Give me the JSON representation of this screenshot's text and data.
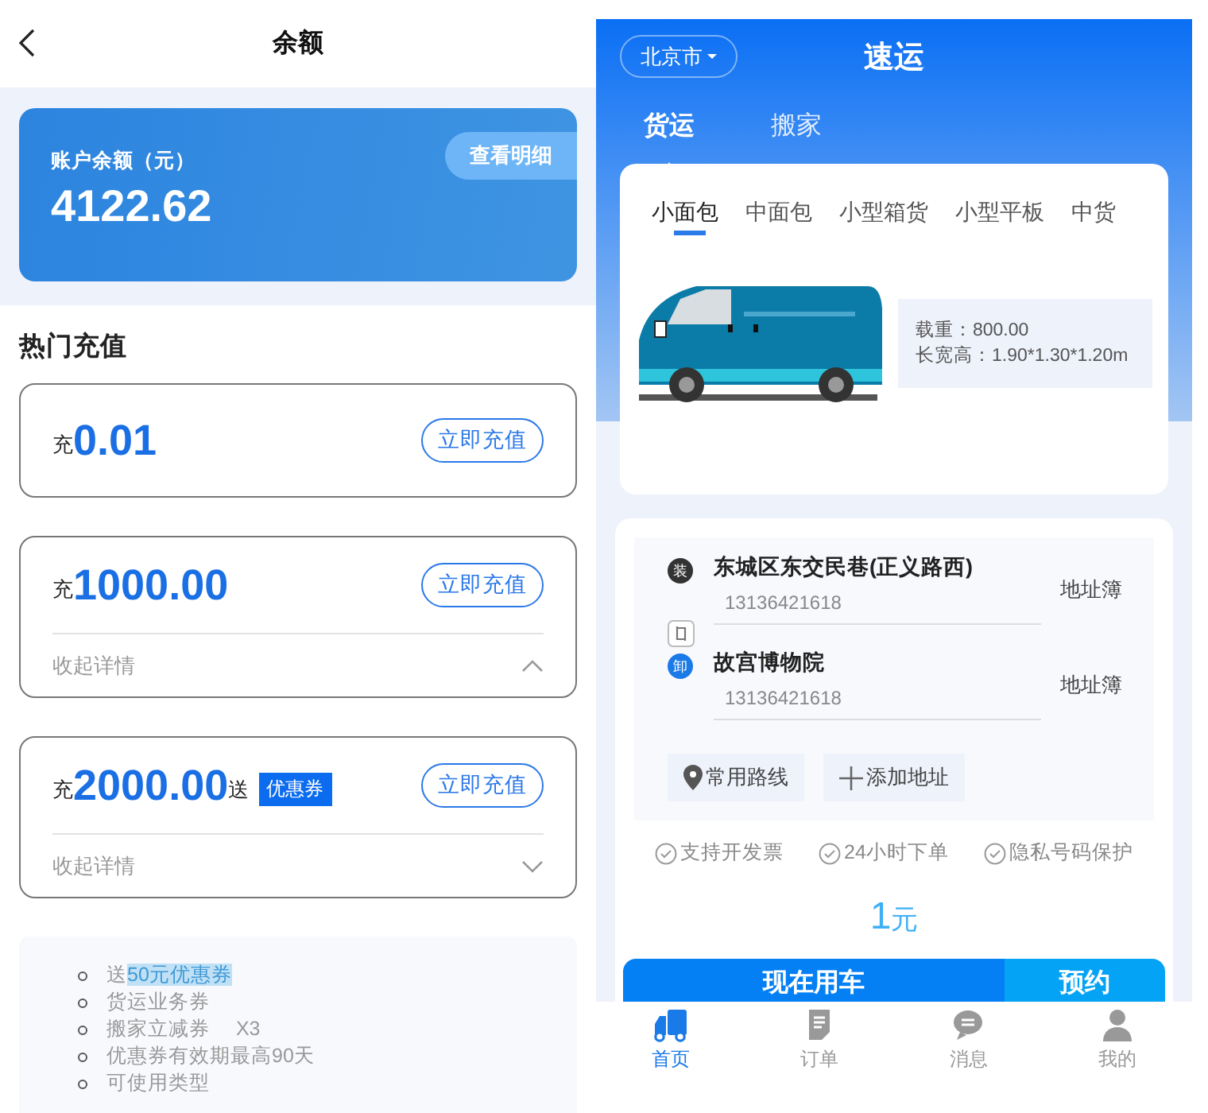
{
  "balance_screen": {
    "title": "余额",
    "balance_card": {
      "label": "账户余额（元）",
      "amount": "4122.62",
      "detail_button": "查看明细"
    },
    "section_title": "热门充值",
    "packages": [
      {
        "prefix": "充",
        "amount": "0.01",
        "button": "立即充值"
      },
      {
        "prefix": "充",
        "amount": "1000.00",
        "button": "立即充值",
        "details_label": "收起详情",
        "expanded": true
      },
      {
        "prefix": "充",
        "amount": "2000.00",
        "bonus_text": "送",
        "bonus_tag": "优惠券",
        "button": "立即充值",
        "details_label": "收起详情",
        "expanded": false
      }
    ],
    "benefits": [
      {
        "text": "送",
        "highlight": "50元优惠券"
      },
      {
        "text": "货运业务券"
      },
      {
        "text": "搬家立减券　 X3"
      },
      {
        "text": "优惠券有效期最高90天"
      },
      {
        "text": "可使用类型"
      }
    ]
  },
  "freight_screen": {
    "city": "北京市",
    "title": "速运",
    "service_tabs": [
      {
        "label": "货运",
        "selected": true
      },
      {
        "label": "搬家",
        "selected": false
      }
    ],
    "vehicle_tabs": [
      {
        "label": "小面包",
        "selected": true
      },
      {
        "label": "中面包",
        "selected": false
      },
      {
        "label": "小型箱货",
        "selected": false
      },
      {
        "label": "小型平板",
        "selected": false
      },
      {
        "label": "中货",
        "selected": false
      }
    ],
    "vehicle_specs": [
      "载重：800.00",
      "长宽高：1.90*1.30*1.20m"
    ],
    "stops": [
      {
        "kind": "load",
        "badge": "装",
        "address": "东城区东交民巷(正义路西)",
        "phone": "13136421618",
        "link": "地址簿"
      },
      {
        "kind": "unload",
        "badge": "卸",
        "address": "故宫博物院",
        "phone": "13136421618",
        "link": "地址簿"
      }
    ],
    "route_buttons": [
      {
        "kind": "route",
        "label": "常用路线"
      },
      {
        "kind": "add",
        "label": "添加地址"
      }
    ],
    "features": [
      "支持开发票",
      "24小时下单",
      "隐私号码保护"
    ],
    "price": {
      "amount": "1",
      "unit": "元"
    },
    "actions": [
      {
        "kind": "primary",
        "label": "现在用车"
      },
      {
        "kind": "secondary",
        "label": "预约"
      }
    ],
    "nav": [
      {
        "kind": "truck",
        "label": "首页",
        "selected": true
      },
      {
        "kind": "document",
        "label": "订单",
        "selected": false
      },
      {
        "kind": "chat",
        "label": "消息",
        "selected": false
      },
      {
        "kind": "person",
        "label": "我的",
        "selected": false
      }
    ]
  }
}
